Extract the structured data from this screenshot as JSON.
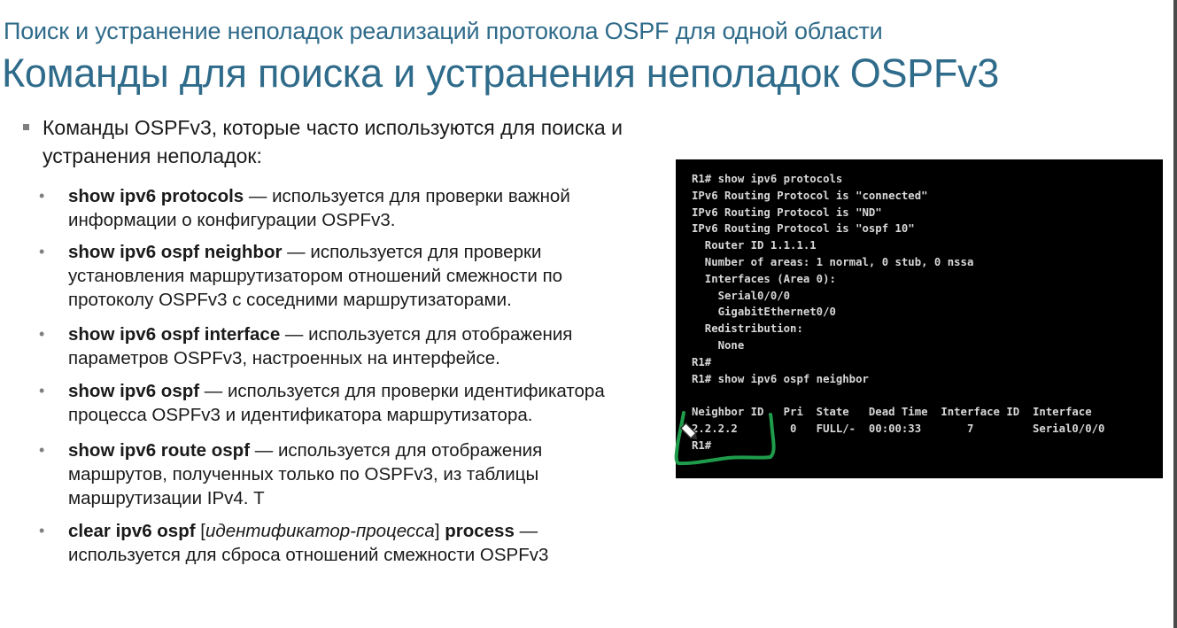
{
  "slide": {
    "subtitle": "Поиск и устранение неполадок реализаций протокола OSPF для одной области",
    "title": "Команды для поиска и устранения неполадок OSPFv3",
    "intro": "Команды OSPFv3, которые часто используются для поиска и устранения неполадок:",
    "dash": " — ",
    "items": [
      {
        "cmd": "show ipv6 protocols",
        "desc": "используется для проверки важной информации о конфигурации OSPFv3."
      },
      {
        "cmd": "show ipv6 ospf neighbor",
        "desc": "используется для проверки установления маршрутизатором отношений смежности по протоколу OSPFv3 с соседними маршрутизаторами."
      },
      {
        "cmd": "show ipv6 ospf interface",
        "desc": "используется для отображения параметров OSPFv3, настроенных на интерфейсе."
      },
      {
        "cmd": "show ipv6 ospf",
        "desc": "используется для проверки идентификатора процесса OSPFv3 и идентификатора маршрутизатора."
      },
      {
        "cmd": "show ipv6 route ospf",
        "desc": "используется для отображения маршрутов, полученных только по OSPFv3, из таблицы маршрутизации IPv4. Т"
      },
      {
        "cmd_a": "clear ipv6 ospf",
        "open": " [",
        "param": "идентификатор-процесса",
        "close": "] ",
        "cmd_b": "process",
        "desc": "используется для сброса отношений смежности OSPFv3"
      }
    ]
  },
  "terminal": {
    "lines": [
      "R1# show ipv6 protocols",
      "IPv6 Routing Protocol is \"connected\"",
      "IPv6 Routing Protocol is \"ND\"",
      "IPv6 Routing Protocol is \"ospf 10\"",
      "  Router ID 1.1.1.1",
      "  Number of areas: 1 normal, 0 stub, 0 nssa",
      "  Interfaces (Area 0):",
      "    Serial0/0/0",
      "    GigabitEthernet0/0",
      "  Redistribution:",
      "    None",
      "R1#",
      "R1# show ipv6 ospf neighbor",
      "",
      "Neighbor ID   Pri  State   Dead Time  Interface ID  Interface",
      "2.2.2.2        0   FULL/-  00:00:33       7         Serial0/0/0",
      "R1#"
    ]
  },
  "colors": {
    "title": "#2f6b8a",
    "annotation": "#1e9c4b",
    "terminal_bg": "#000000"
  }
}
